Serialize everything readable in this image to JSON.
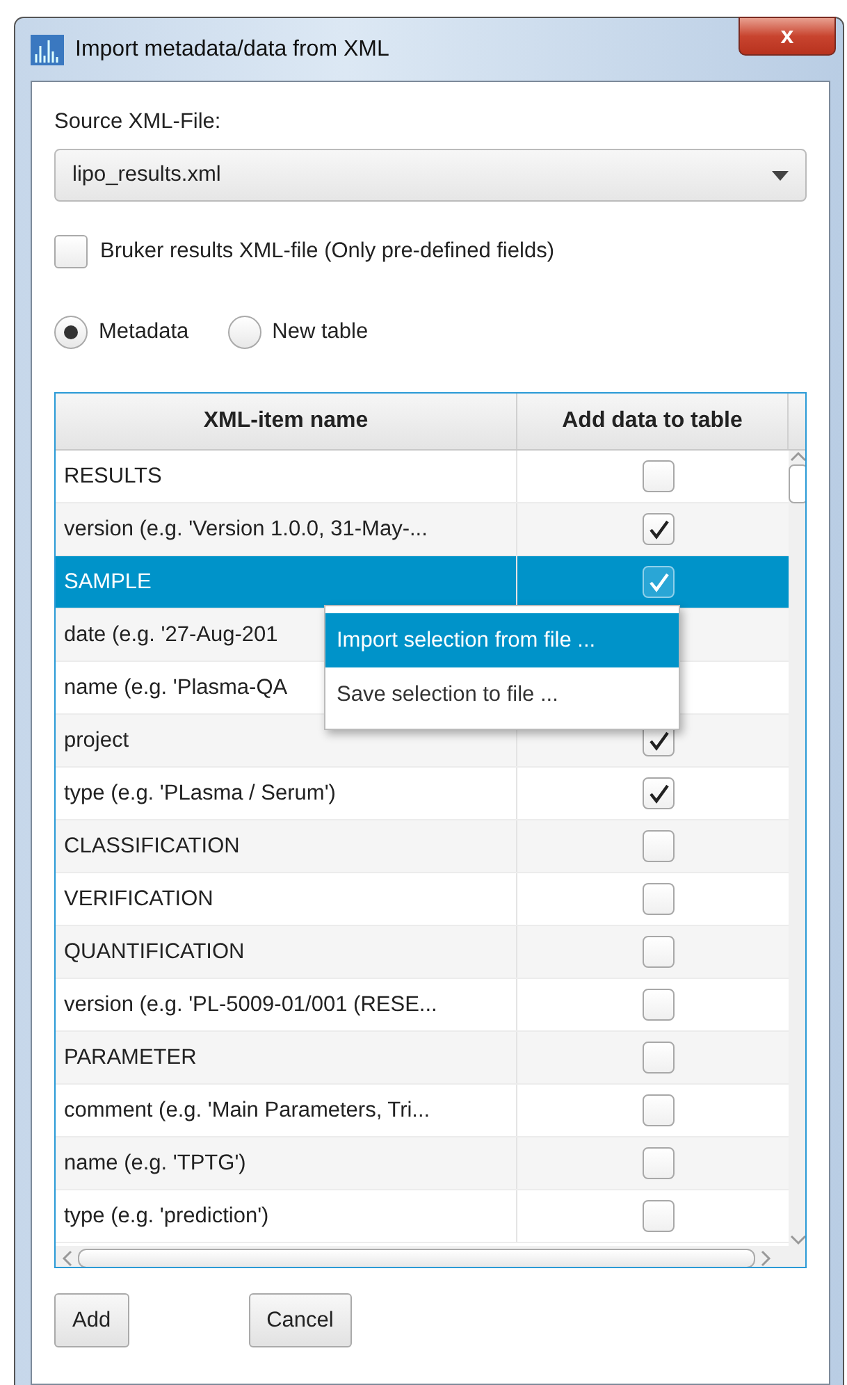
{
  "window": {
    "title": "Import metadata/data from XML",
    "close": "x"
  },
  "source": {
    "label": "Source XML-File:",
    "value": "lipo_results.xml"
  },
  "bruker_checkbox": {
    "label": "Bruker results XML-file (Only pre-defined fields)",
    "checked": false
  },
  "mode": [
    {
      "label": "Metadata",
      "selected": true
    },
    {
      "label": "New table",
      "selected": false
    }
  ],
  "table": {
    "columns": [
      "XML-item name",
      "Add data to table"
    ],
    "rows": [
      {
        "name": "RESULTS",
        "checked": false,
        "selected": false
      },
      {
        "name": "version (e.g. 'Version 1.0.0, 31-May-...",
        "checked": true,
        "selected": false
      },
      {
        "name": "SAMPLE",
        "checked": true,
        "selected": true
      },
      {
        "name": "date (e.g. '27-Aug-201",
        "selected": false
      },
      {
        "name": "name (e.g. 'Plasma-QA",
        "selected": false
      },
      {
        "name": "project",
        "checked": true,
        "selected": false
      },
      {
        "name": "type (e.g. 'PLasma / Serum')",
        "checked": true,
        "selected": false
      },
      {
        "name": "CLASSIFICATION",
        "checked": false,
        "selected": false
      },
      {
        "name": "VERIFICATION",
        "checked": false,
        "selected": false
      },
      {
        "name": "QUANTIFICATION",
        "checked": false,
        "selected": false
      },
      {
        "name": "version (e.g. 'PL-5009-01/001  (RESE...",
        "checked": false,
        "selected": false
      },
      {
        "name": "PARAMETER",
        "checked": false,
        "selected": false
      },
      {
        "name": "comment (e.g. 'Main Parameters, Tri...",
        "checked": false,
        "selected": false
      },
      {
        "name": "name (e.g. 'TPTG')",
        "checked": false,
        "selected": false
      },
      {
        "name": "type (e.g. 'prediction')",
        "checked": false,
        "selected": false
      }
    ]
  },
  "context_menu": {
    "items": [
      {
        "label": "Import selection from file ...",
        "selected": true
      },
      {
        "label": "Save selection to file ...",
        "selected": false
      }
    ]
  },
  "buttons": [
    "Add",
    "Cancel"
  ]
}
